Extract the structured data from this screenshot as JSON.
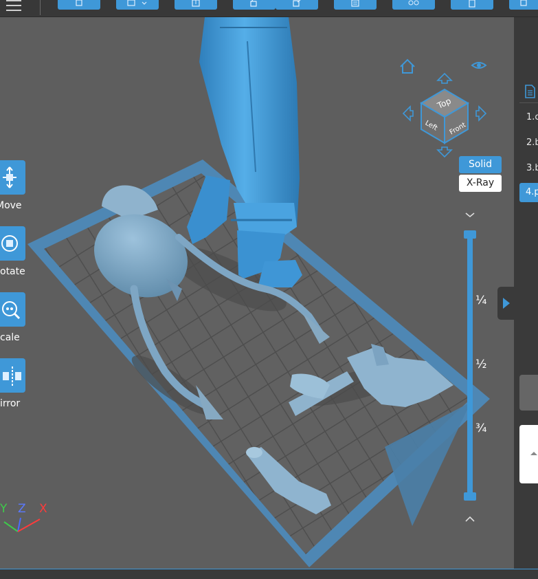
{
  "toolbar": {
    "menu_icon": "hamburger-icon",
    "buttons": [
      "open-file-icon",
      "new-project-icon",
      "import-icon",
      "export-icon",
      "edit-icon",
      "layers-icon",
      "supports-icon",
      "slice-icon",
      "print-icon"
    ]
  },
  "view_cube": {
    "top": "Top",
    "left": "Left",
    "front": "Front",
    "home_icon": "home-icon",
    "visibility_icon": "eye-icon"
  },
  "display_mode": {
    "solid": "Solid",
    "xray": "X-Ray",
    "active": "Solid"
  },
  "left_tools": [
    {
      "label": "Move",
      "visible": "Move",
      "icon": "move-icon"
    },
    {
      "label": "Rotate",
      "visible": "otate",
      "icon": "rotate-icon"
    },
    {
      "label": "Scale",
      "visible": "cale",
      "icon": "scale-icon"
    },
    {
      "label": "Mirror",
      "visible": "irror",
      "icon": "mirror-icon"
    }
  ],
  "layer_slider": {
    "quarter": "¼",
    "half": "½",
    "three_quarter": "¾"
  },
  "axes": {
    "y": "Y",
    "z": "Z",
    "x": "X"
  },
  "parts_list": {
    "items": [
      "1.c",
      "2.b",
      "3.b",
      "4.p"
    ],
    "selected_index": 3
  },
  "colors": {
    "accent": "#3f98d8",
    "model": "#6d9ec1",
    "selected_model": "#3f97d6",
    "background": "#5e5e5e",
    "panel": "#3a3a3a"
  }
}
